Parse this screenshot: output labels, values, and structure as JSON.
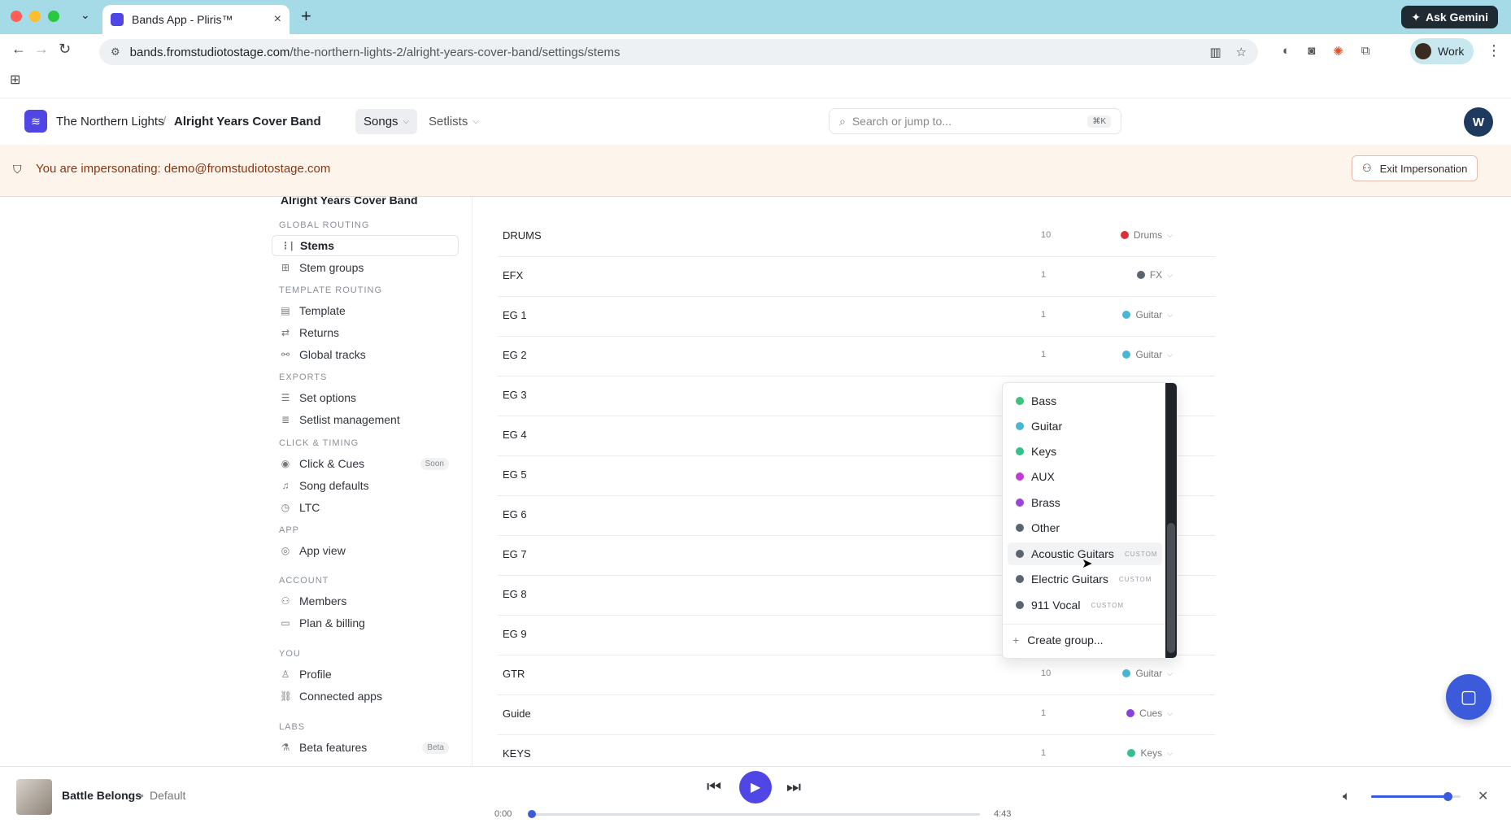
{
  "browser": {
    "tab_title": "Bands App - Pliris™",
    "url_host": "bands.fromstudiotostage.com",
    "url_path": "/the-northern-lights-2/alright-years-cover-band/settings/stems",
    "gemini_label": "Ask Gemini",
    "profile_label": "Work"
  },
  "header": {
    "org": "The Northern Lights",
    "separator": "/",
    "band": "Alright Years Cover Band",
    "nav": [
      {
        "label": "Songs"
      },
      {
        "label": "Setlists"
      }
    ],
    "search_placeholder": "Search or jump to...",
    "search_shortcut": "⌘K",
    "avatar_initial": "W"
  },
  "banner": {
    "text": "You are impersonating: demo@fromstudiotostage.com",
    "exit_label": "Exit Impersonation"
  },
  "sidebar": {
    "band": "Alright Years Cover Band",
    "sections": {
      "global_routing": "GLOBAL ROUTING",
      "template_routing": "TEMPLATE ROUTING",
      "exports": "EXPORTS",
      "click_timing": "CLICK & TIMING",
      "app": "APP",
      "account": "ACCOUNT",
      "you": "YOU",
      "labs": "LABS"
    },
    "items": {
      "stems": "Stems",
      "stem_groups": "Stem groups",
      "template": "Template",
      "returns": "Returns",
      "global_tracks": "Global tracks",
      "set_options": "Set options",
      "setlist_management": "Setlist management",
      "click_cues": "Click & Cues",
      "click_cues_badge": "Soon",
      "song_defaults": "Song defaults",
      "ltc": "LTC",
      "app_view": "App view",
      "members": "Members",
      "plan_billing": "Plan & billing",
      "profile": "Profile",
      "connected_apps": "Connected apps",
      "beta_features": "Beta features",
      "beta_badge": "Beta"
    }
  },
  "stems": {
    "rows": [
      {
        "name": "DRUMS",
        "count": "10",
        "group": "Drums",
        "color": "#dc2f3c"
      },
      {
        "name": "EFX",
        "count": "1",
        "group": "FX",
        "color": "#5b6472"
      },
      {
        "name": "EG 1",
        "count": "1",
        "group": "Guitar",
        "color": "#49b6d6"
      },
      {
        "name": "EG 2",
        "count": "1",
        "group": "Guitar",
        "color": "#49b6d6"
      },
      {
        "name": "EG 3",
        "count": "",
        "group": "",
        "color": ""
      },
      {
        "name": "EG 4",
        "count": "",
        "group": "",
        "color": ""
      },
      {
        "name": "EG 5",
        "count": "",
        "group": "",
        "color": ""
      },
      {
        "name": "EG 6",
        "count": "",
        "group": "",
        "color": ""
      },
      {
        "name": "EG 7",
        "count": "",
        "group": "",
        "color": ""
      },
      {
        "name": "EG 8",
        "count": "",
        "group": "",
        "color": ""
      },
      {
        "name": "EG 9",
        "count": "",
        "group": "",
        "color": ""
      },
      {
        "name": "GTR",
        "count": "10",
        "group": "Guitar",
        "color": "#49b6d6"
      },
      {
        "name": "Guide",
        "count": "1",
        "group": "Cues",
        "color": "#8b3fe0"
      },
      {
        "name": "KEYS",
        "count": "1",
        "group": "Keys",
        "color": "#34c08a"
      }
    ]
  },
  "dropdown": {
    "items": [
      {
        "label": "Bass",
        "color": "#3cc47c",
        "tag": ""
      },
      {
        "label": "Guitar",
        "color": "#49b6d6",
        "tag": ""
      },
      {
        "label": "Keys",
        "color": "#34c08a",
        "tag": ""
      },
      {
        "label": "AUX",
        "color": "#c53ad6",
        "tag": ""
      },
      {
        "label": "Brass",
        "color": "#9b45d8",
        "tag": ""
      },
      {
        "label": "Other",
        "color": "#5b6472",
        "tag": ""
      },
      {
        "label": "Acoustic Guitars",
        "color": "#5b6472",
        "tag": "CUSTOM"
      },
      {
        "label": "Electric Guitars",
        "color": "#5b6472",
        "tag": "CUSTOM"
      },
      {
        "label": "911 Vocal",
        "color": "#5b6472",
        "tag": "CUSTOM"
      }
    ],
    "create_label": "Create group..."
  },
  "player": {
    "title": "Battle Belongs",
    "separator": "•",
    "variant": "Default",
    "elapsed": "0:00",
    "duration": "4:43",
    "progress_fraction": 0,
    "volume_fraction": 0.85
  },
  "colors": {
    "accent": "#4f46e5",
    "banner_text": "#8a3512"
  }
}
